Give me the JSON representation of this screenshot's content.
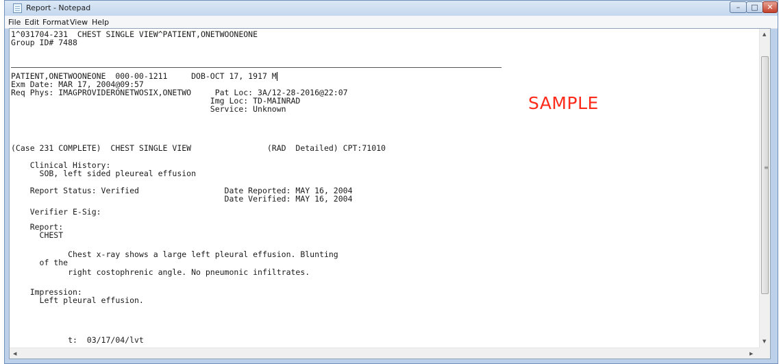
{
  "window": {
    "title": "Report - Notepad"
  },
  "caption_buttons": {
    "minimize": "–",
    "maximize": "□",
    "close": "✕"
  },
  "menu": [
    "File",
    "Edit",
    "Format",
    "View",
    "Help"
  ],
  "document": {
    "lines": [
      "1^031704-231  CHEST SINGLE VIEW^PATIENT,ONETWOONEONE",
      "Group ID# 7488",
      "PATIENT,ONETWOONEONE  000-00-1211     DOB-OCT 17, 1917 M",
      "Exm Date: MAR 17, 2004@09:57",
      "Req Phys: IMAGPROVIDERONETWOSIX,ONETWO     Pat Loc: 3A/12-28-2016@22:07",
      "                                          Img Loc: TD-MAINRAD",
      "                                          Service: Unknown",
      "(Case 231 COMPLETE)  CHEST SINGLE VIEW                (RAD  Detailed) CPT:71010",
      "    Clinical History:",
      "      SOB, left sided pleureal effusion",
      "    Report Status: Verified                  Date Reported: MAY 16, 2004",
      "                                             Date Verified: MAY 16, 2004",
      "    Verifier E-Sig:",
      "    Report:",
      "      CHEST",
      "            Chest x-ray shows a large left pleural effusion. Blunting",
      "      of the",
      "            right costophrenic angle. No pneumonic infiltrates.",
      "    Impression:",
      "      Left pleural effusion.",
      "            t:  03/17/04/lvt"
    ],
    "watermark": "SAMPLE"
  },
  "icons": {
    "app": "notepad-icon",
    "scroll_up": "▲",
    "scroll_down": "▼",
    "scroll_left": "◀",
    "scroll_right": "▶",
    "grip": "≡"
  }
}
